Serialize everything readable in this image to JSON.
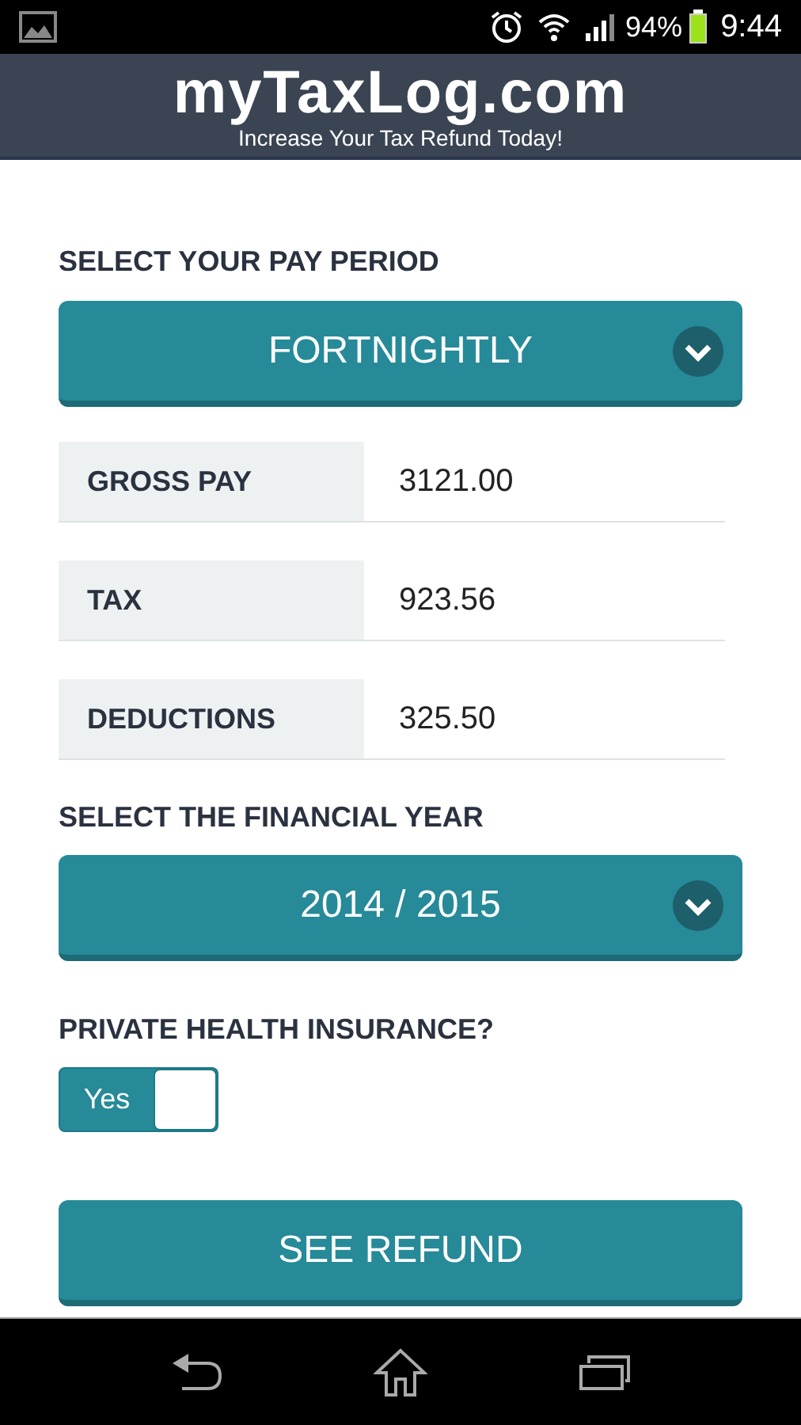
{
  "status_bar": {
    "battery": "94%",
    "time": "9:44"
  },
  "header": {
    "logo": "myTaxLog.com",
    "tagline": "Increase Your Tax Refund Today!"
  },
  "pay_period": {
    "label": "SELECT YOUR PAY PERIOD",
    "value": "FORTNIGHTLY"
  },
  "fields": [
    {
      "label": "GROSS PAY",
      "value": "3121.00"
    },
    {
      "label": "TAX",
      "value": "923.56"
    },
    {
      "label": "DEDUCTIONS",
      "value": "325.50"
    }
  ],
  "financial_year": {
    "label": "SELECT THE FINANCIAL YEAR",
    "value": "2014 / 2015"
  },
  "health_insurance": {
    "label": "PRIVATE HEALTH INSURANCE?",
    "toggle_text": "Yes",
    "on": true
  },
  "button": "SEE REFUND"
}
